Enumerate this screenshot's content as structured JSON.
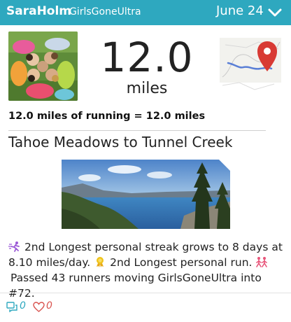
{
  "header": {
    "user_name": "SaraHolm",
    "team_name": "GirlsGoneUltra",
    "date": "June 24",
    "bg_color": "#2ea8bf"
  },
  "activity": {
    "distance": "12.0",
    "unit": "miles",
    "summary": "12.0 miles of running = 12.0 miles",
    "title": "Tahoe Meadows to Tunnel Creek"
  },
  "achievements": {
    "line1_icon": "runner-streak-icon",
    "line1": "2nd Longest personal streak grows to 8 days at 8.10 miles/day.",
    "line2_icon": "medal-icon",
    "line2": "2nd Longest personal run.",
    "line3_icon": "runners-icon",
    "line3": "Passed 43 runners moving GirlsGoneUltra into #72."
  },
  "footer": {
    "comment_count": "0",
    "like_count": "0"
  }
}
